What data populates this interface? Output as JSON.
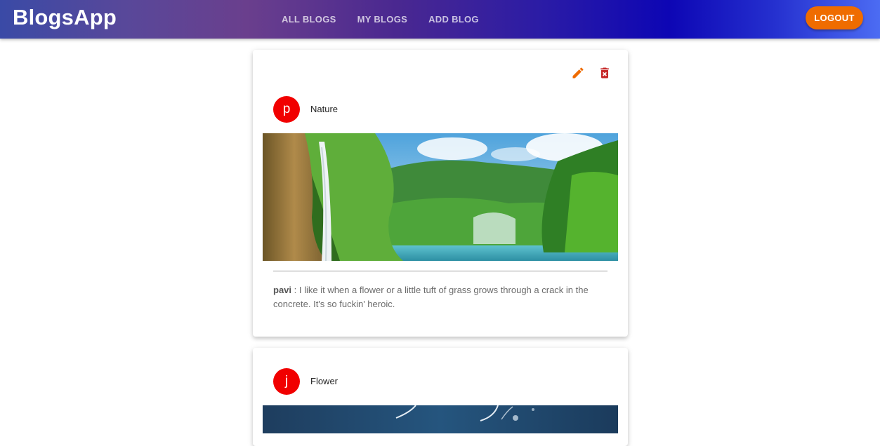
{
  "app": {
    "brand": "BlogsApp",
    "nav_tabs": [
      "ALL BLOGS",
      "MY BLOGS",
      "ADD BLOG"
    ],
    "logout_label": "LOGOUT",
    "colors": {
      "accent": "#ef6c00",
      "avatar": "#f10000",
      "delete": "#c62828"
    }
  },
  "blogs": [
    {
      "avatar_letter": "p",
      "title": "Nature",
      "author": "pavi",
      "separator": " : ",
      "description": "I like it when a flower or a little tuft of grass grows through a crack in the concrete. It's so fuckin' heroic.",
      "actions": [
        "edit-icon",
        "delete-icon"
      ],
      "image": "waterfall-lake-forest"
    },
    {
      "avatar_letter": "j",
      "title": "Flower",
      "image": "dark-blue-flower"
    }
  ]
}
